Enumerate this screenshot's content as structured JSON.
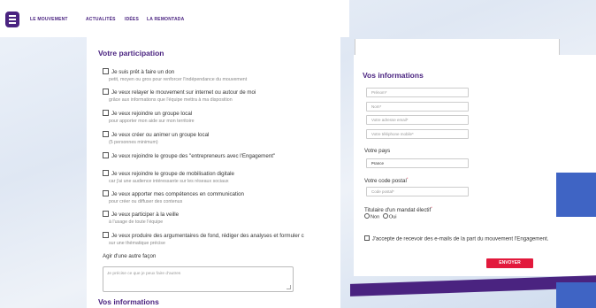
{
  "nav": {
    "items": [
      "LE MOUVEMENT",
      "ACTUALITÉS",
      "IDÉES",
      "LA REMONTADA"
    ]
  },
  "participation": {
    "title": "Votre participation",
    "options": [
      {
        "label": "Je suis prêt à faire un don",
        "sub": "petit, moyen ou gros pour renforcer l'indépendance du mouvement"
      },
      {
        "label": "Je veux relayer le mouvement sur internet ou autour de moi",
        "sub": "grâce aux informations que l'équipe mettra à ma disposition"
      },
      {
        "label": "Je veux rejoindre un groupe local",
        "sub": "pour apporter mon aide sur mon territoire"
      },
      {
        "label": "Je veux créer ou animer un groupe local",
        "sub": "(5 personnes minimum)"
      },
      {
        "label": "Je veux rejoindre le groupe des \"entrepreneurs avec l'Engagement\"",
        "sub": ""
      },
      {
        "label": "Je veux rejoindre le groupe de mobilisation digitale",
        "sub": "car j'ai une audience intéressante sur les réseaux sociaux"
      },
      {
        "label": "Je veux apporter mes compétences en communication",
        "sub": "pour créer ou diffuser des contenus"
      },
      {
        "label": "Je veux participer à la veille",
        "sub": "à l'usage de toute l'équipe"
      },
      {
        "label": "Je veux produire des argumentaires de fond, rédiger des analyses et formuler c",
        "sub": "sur une thématique précise"
      }
    ],
    "other_label": "Agir d'une autre façon",
    "other_placeholder": "Je précise ce que je peux faire d'autres",
    "bottom_title": "Vos informations"
  },
  "info": {
    "title": "Vos informations",
    "fields": [
      "Prénom*",
      "Nom*",
      "Votre adresse email*",
      "Votre téléphone mobile*"
    ],
    "country_label": "Votre pays",
    "country_value": "France",
    "postal_label": "Votre code postal",
    "postal_asterisk": "*",
    "postal_placeholder": "Code postal*",
    "mandate_label": "Titulaire d'un mandat électif",
    "mandate_asterisk": "*",
    "mandate_no": "Non",
    "mandate_yes": "Oui",
    "consent": "J'accepte de recevoir des e-mails de la part du mouvement l'Engagement.",
    "send_label": "ENVOYER"
  },
  "colors": {
    "brand": "#4a2380",
    "accent": "#e2193c",
    "blue": "#3f64c4"
  }
}
